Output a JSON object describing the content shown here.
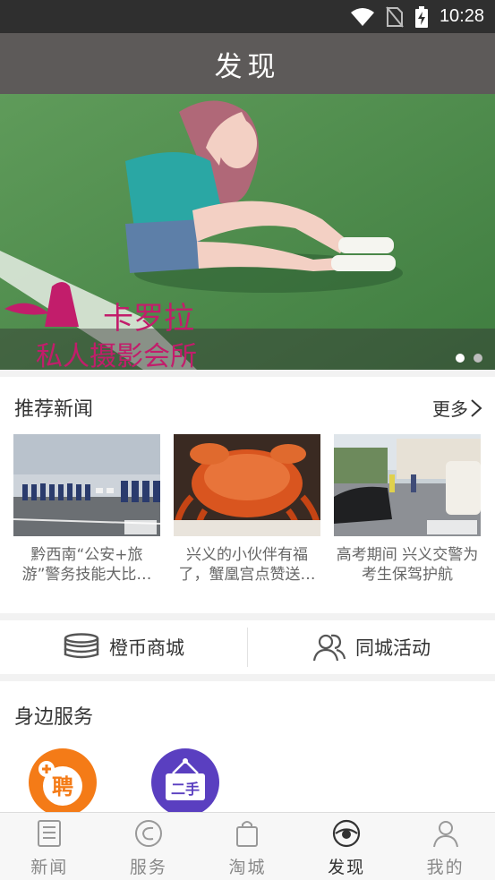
{
  "status_bar": {
    "time": "10:28"
  },
  "header": {
    "title": "发现"
  },
  "banner": {
    "brand_name": "卡罗拉",
    "brand_subtitle": "私人摄影会所",
    "slide_count": 2,
    "active_slide": 1
  },
  "news": {
    "title": "推荐新闻",
    "more_label": "更多",
    "items": [
      {
        "caption": "黔西南“公安+旅游”警务技能大比…"
      },
      {
        "caption": "兴义的小伙伴有福了，蟹凰宫点赞送…"
      },
      {
        "caption": "高考期间 兴义交警为考生保驾护航"
      }
    ]
  },
  "shortcuts": {
    "coin_mall": "橙币商城",
    "city_events": "同城活动"
  },
  "services": {
    "title": "身边服务",
    "items": [
      {
        "icon": "recruit-icon",
        "glyph": "聘",
        "color": "#f47b17"
      },
      {
        "icon": "second-hand-icon",
        "glyph": "二手",
        "color": "#5a3fc0"
      }
    ]
  },
  "bottom_nav": {
    "items": [
      {
        "label": "新闻",
        "icon": "newspaper-icon"
      },
      {
        "label": "服务",
        "icon": "service-icon"
      },
      {
        "label": "淘城",
        "icon": "shopping-bag-icon"
      },
      {
        "label": "发现",
        "icon": "eye-icon"
      },
      {
        "label": "我的",
        "icon": "user-icon"
      }
    ],
    "active_index": 3
  },
  "colors": {
    "header_bg": "#5d5a59",
    "status_bg": "#2f2f2f",
    "accent_orange": "#f47b17",
    "accent_purple": "#5a3fc0"
  }
}
